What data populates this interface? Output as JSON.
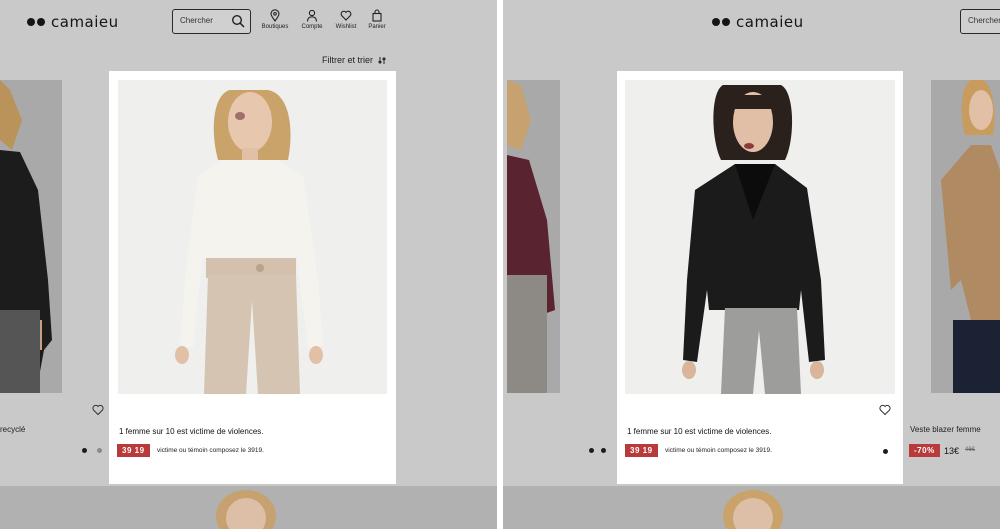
{
  "left": {
    "brand": "camaieu",
    "search": {
      "placeholder": "Chercher"
    },
    "nav": [
      {
        "label": "Boutiques",
        "icon": "location-pin-icon"
      },
      {
        "label": "Compte",
        "icon": "user-icon"
      },
      {
        "label": "Wishlist",
        "icon": "heart-icon"
      },
      {
        "label": "Panier",
        "icon": "bag-icon"
      }
    ],
    "filter_label": "Filtrer et trier",
    "bg_product_name": "recyclé",
    "message": "1 femme sur 10 est victime de violences.",
    "hotline_badge": "39 19",
    "hotline_text": "victime ou témoin composez le 3919."
  },
  "right": {
    "brand": "camaieu",
    "search": {
      "placeholder": "Chercher"
    },
    "message": "1 femme sur 10 est victime de violences.",
    "hotline_badge": "39 19",
    "hotline_text": "victime ou témoin composez le 3919.",
    "bg_product_name": "Veste blazer femme",
    "discount_badge": "-70%",
    "price": "13€",
    "old_price": "46€"
  },
  "colors": {
    "overlay": "#c9c9c9",
    "badge_red": "#b83a3a",
    "modal": "#ffffff"
  }
}
